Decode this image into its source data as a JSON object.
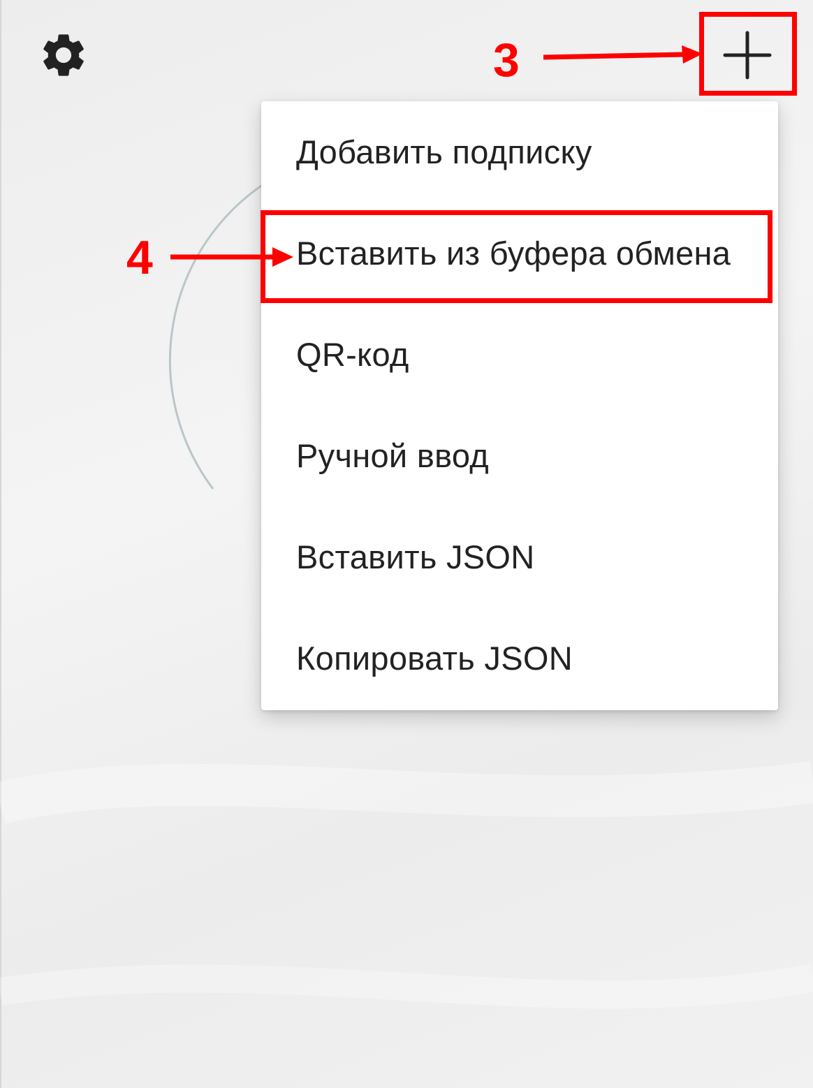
{
  "toolbar": {
    "settings_icon": "gear-icon",
    "add_icon": "plus-icon"
  },
  "menu": {
    "items": [
      {
        "label": "Добавить подписку"
      },
      {
        "label": "Вставить из буфера обмена"
      },
      {
        "label": "QR-код"
      },
      {
        "label": "Ручной ввод"
      },
      {
        "label": "Вставить JSON"
      },
      {
        "label": "Копировать JSON"
      }
    ]
  },
  "annotations": {
    "step3": "3",
    "step4": "4",
    "color": "#ff0000"
  }
}
